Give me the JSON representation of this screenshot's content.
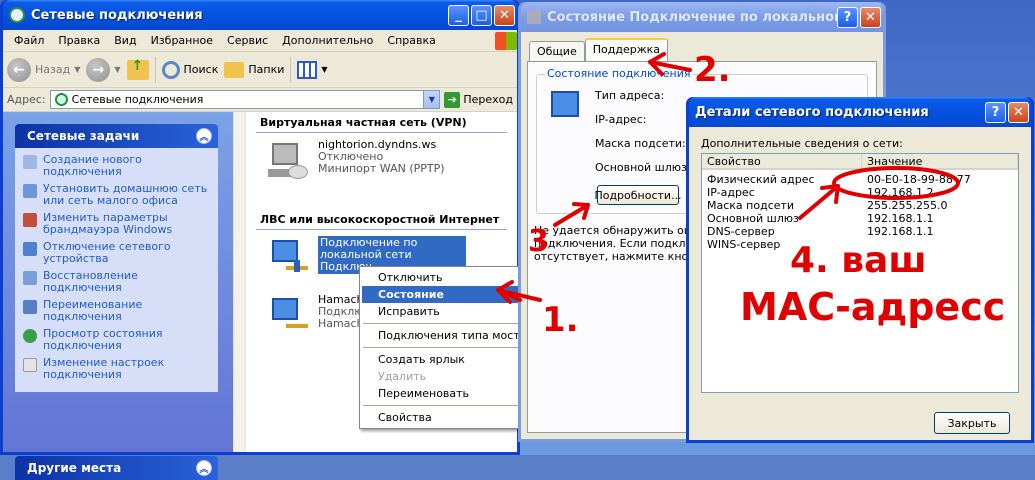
{
  "explorer": {
    "title": "Сетевые подключения",
    "menu": [
      "Файл",
      "Правка",
      "Вид",
      "Избранное",
      "Сервис",
      "Дополнительно",
      "Справка"
    ],
    "toolbar": {
      "back": "Назад",
      "search": "Поиск",
      "folders": "Папки"
    },
    "address": {
      "label": "Адрес:",
      "value": "Сетевые подключения",
      "go": "Переход"
    },
    "network_tasks": {
      "title": "Сетевые задачи",
      "items": [
        "Создание нового подключения",
        "Установить домашнюю сеть или сеть малого офиса",
        "Изменить параметры брандмауэра Windows",
        "Отключение сетевого устройства",
        "Восстановление подключения",
        "Переименование подключения",
        "Просмотр состояния подключения",
        "Изменение настроек подключения"
      ]
    },
    "other_places": {
      "title": "Другие места"
    },
    "groups": [
      {
        "title": "Виртуальная частная сеть (VPN)"
      },
      {
        "title": "ЛВС или высокоскоростной Интернет"
      }
    ],
    "connections": [
      {
        "name": "nightorion.dyndns.ws",
        "status": "Отключено",
        "device": "Минипорт WAN (PPTP)"
      },
      {
        "name": "Подключение по локальной сети",
        "status": "Подключ"
      },
      {
        "name": "Hamachi",
        "status": "Подключ",
        "device": "Hamachi N"
      }
    ]
  },
  "context_menu": {
    "items": [
      "Отключить",
      "Состояние",
      "Исправить",
      "Подключения типа мост",
      "Создать ярлык",
      "Удалить",
      "Переименовать",
      "Свойства"
    ]
  },
  "status_dialog": {
    "title": "Состояние Подключение по локальной сети",
    "tabs": [
      "Общие",
      "Поддержка"
    ],
    "group": "Состояние подключения",
    "fields": [
      "Тип адреса:",
      "IP-адрес:",
      "Маска подсети:",
      "Основной шлюз:"
    ],
    "details_button": "Подробности...",
    "text": [
      "Не удается обнаружить оши",
      "подключения. Если подключ",
      "отсутствует, нажмите кнопк"
    ]
  },
  "details_dialog": {
    "title": "Детали сетевого подключения",
    "caption": "Дополнительные сведения о сети:",
    "columns": [
      "Свойство",
      "Значение"
    ],
    "rows": [
      [
        "Физический адрес",
        "00-E0-18-99-88-77"
      ],
      [
        "IP-адрес",
        "192.168.1.2"
      ],
      [
        "Маска подсети",
        "255.255.255.0"
      ],
      [
        "Основной шлюз",
        "192.168.1.1"
      ],
      [
        "DNS-сервер",
        "192.168.1.1"
      ],
      [
        "WINS-сервер",
        ""
      ]
    ],
    "close_button": "Закрыть"
  },
  "annotations": {
    "step1": "1.",
    "step2": "2.",
    "step3": "3",
    "step4_line1": "4. ваш",
    "step4_line2": "МАС-адресс"
  }
}
